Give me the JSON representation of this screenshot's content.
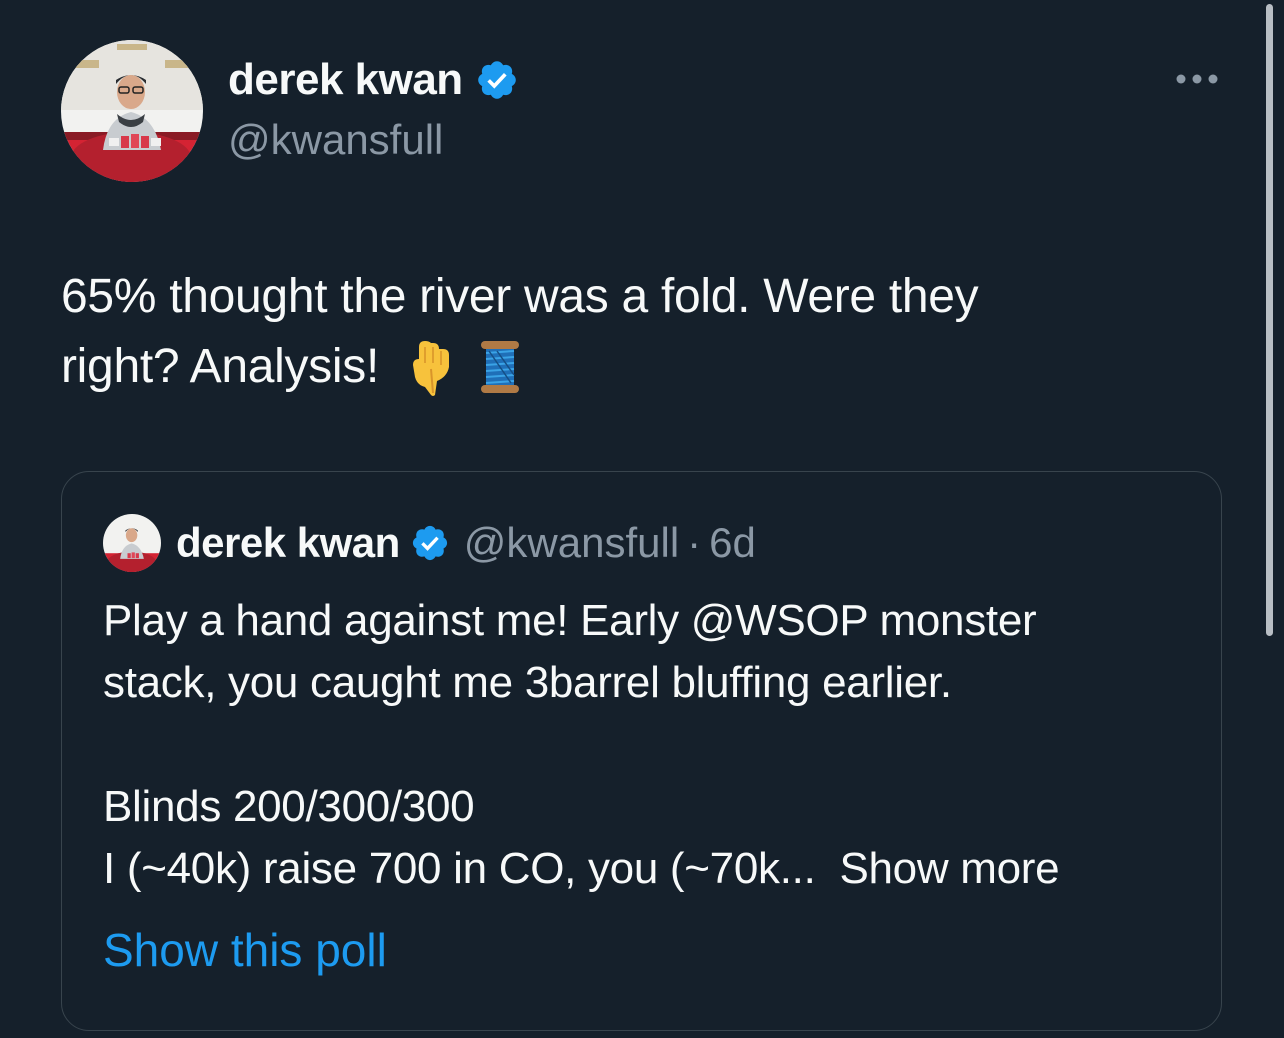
{
  "tweet": {
    "author_name": "derek kwan",
    "author_handle": "@kwansfull",
    "text_line1": "65% thought the river was a fold. Were they",
    "text_line2": "right? Analysis!",
    "emojis": [
      "backhand-index-pointing-down-icon",
      "spool-of-thread-icon"
    ]
  },
  "quote": {
    "author_name": "derek kwan",
    "author_handle": "@kwansfull",
    "separator": "·",
    "time": "6d",
    "lines": [
      "Play a hand against me! Early @WSOP monster",
      "stack, you caught me 3barrel bluffing earlier.",
      "",
      "Blinds 200/300/300"
    ],
    "last_line": "I (~40k) raise 700 in CO, you (~70k...",
    "show_more": "Show more",
    "show_poll": "Show this poll"
  },
  "colors": {
    "background": "#15202b",
    "text": "#f7f9f9",
    "secondary": "#8b98a5",
    "accent": "#1d9bf0",
    "border": "#38444d"
  }
}
